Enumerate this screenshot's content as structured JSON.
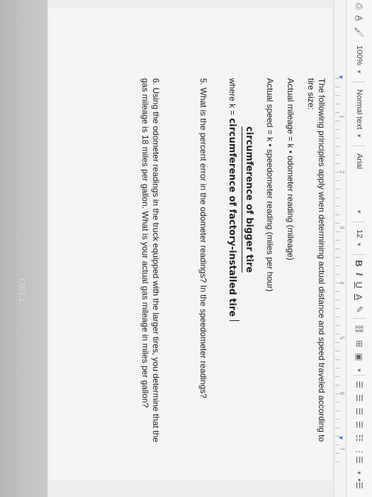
{
  "toolbar": {
    "zoom": "100%",
    "style": "Normal text",
    "font": "Arial",
    "size": "12",
    "bold": "B",
    "italic": "I",
    "underline": "U",
    "text_color": "A"
  },
  "ruler": {
    "marks": [
      "1",
      "2",
      "3",
      "4",
      "5",
      "6",
      "7"
    ]
  },
  "document": {
    "intro": "The following principles apply when determining actual distance and speed traveled according to tire size:",
    "mileage_formula": "Actual mileage = k • odometer reading (mileage)",
    "speed_formula": "Actual speed = k • speedometer reading (miles per hour)",
    "where_label": "where k =",
    "fraction_numerator": "circumference of bigger tire",
    "fraction_denominator": "circumference of factory-installed tire",
    "q5": "5. What is the percent error in the odometer readings? In the speedometer readings?",
    "q6": "6. Using the odometer readings in the truck equipped with the larger tires, you determine that the gas mileage is 18 miles per gallon. What is your actual gas mileage in miles per gallon?"
  },
  "device": {
    "brand": "DELL"
  }
}
